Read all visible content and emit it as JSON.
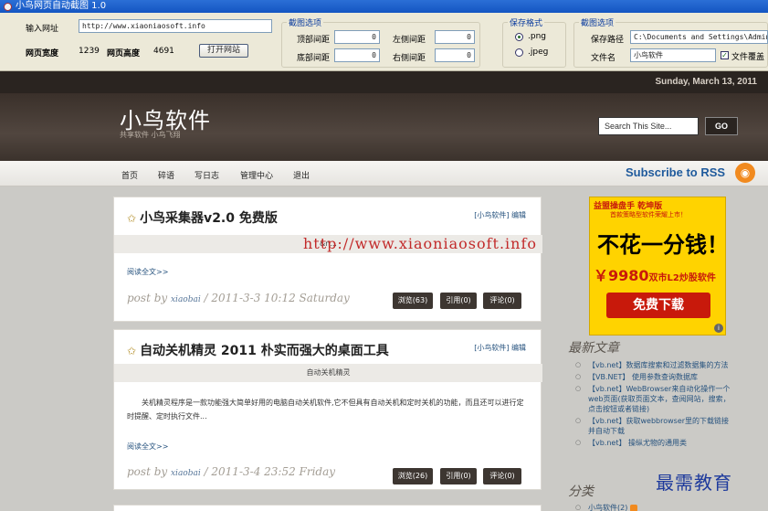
{
  "window": {
    "title": "小鸟网页自动截图 1.0"
  },
  "toolbar": {
    "url_label": "输入网址",
    "url_value": "http://www.xiaoniaosoft.info",
    "width_label": "网页宽度",
    "width_value": "1239",
    "height_label": "网页高度",
    "height_value": "4691",
    "open_button": "打开网站",
    "capture_group": "截图选项",
    "top_label": "顶部间距",
    "top_value": "0",
    "left_label": "左侧间距",
    "left_value": "0",
    "bottom_label": "底部间距",
    "bottom_value": "0",
    "right_label": "右侧间距",
    "right_value": "0",
    "format_group": "保存格式",
    "format_png": ".png",
    "format_jpeg": ".jpeg",
    "format_selected": "png",
    "save_group": "截图选项",
    "save_path_label": "保存路径",
    "save_path_value": "C:\\Documents and Settings\\Admini",
    "filename_label": "文件名",
    "filename_value": "小鸟软件",
    "overwrite_label": "文件覆盖",
    "overwrite_checked": true
  },
  "site": {
    "date": "Sunday, March 13, 2011",
    "title": "小鸟软件",
    "subtitle": "共享软件  小鸟飞翔",
    "search_placeholder": "Search This Site...",
    "search_button": "GO",
    "nav": [
      "首页",
      "碎语",
      "写日志",
      "管理中心",
      "退出"
    ],
    "subscribe": "Subscribe to RSS"
  },
  "watermark_url": "http://www.xiaoniaosoft.info",
  "posts": [
    {
      "title": "小鸟采集器v2.0 免费版",
      "category": "[小鸟软件]",
      "edit": "编辑",
      "excerpt": "&n...",
      "readmore": "阅读全文>>",
      "meta_prefix": "post by ",
      "author": "xiaobai",
      "meta_date": " / 2011-3-3 10:12 Saturday",
      "views": "浏览(63)",
      "quotes": "引用(0)",
      "comments": "评论(0)"
    },
    {
      "title": "自动关机精灵 2011 朴实而强大的桌面工具",
      "category": "[小鸟软件]",
      "edit": "编辑",
      "excerpt": "自动关机精灵",
      "body": "关机精灵程序是一款功能强大简单好用的电脑自动关机软件,它不但具有自动关机和定时关机的功能，而且还可以进行定时提醒、定时执行文件...",
      "readmore": "阅读全文>>",
      "meta_prefix": "post by ",
      "author": "xiaobai",
      "meta_date": " / 2011-3-4 23:52 Friday",
      "views": "浏览(26)",
      "quotes": "引用(0)",
      "comments": "评论(0)"
    }
  ],
  "ad": {
    "logo": "益盟操盘手 乾坤版",
    "small": "首款策略型软件荣耀上市！",
    "headline": "不花一分钱！",
    "price": "￥9980",
    "price_sub": "双市L2炒股软件",
    "button": "免费下载"
  },
  "sidebar": {
    "recent_title": "最新文章",
    "recent": [
      "【vb.net】数据库搜索和过滤数据集的方法",
      "【VB.NET】 使用参数查询数据库",
      "【vb.net】WebBrowser来自动化操作一个web页面(获取页面文本，查阅网站，搜索，点击按钮或者链接)",
      "【vb.net】获取webbrowser里的下载链接并自动下载",
      "【vb.net】 操纵尤物的通用类"
    ],
    "category_title": "分类",
    "category_item": "小鸟软件(2)"
  },
  "corner_watermark": "最需教育",
  "colors": {
    "accent": "#1f5a9c",
    "header": "#3a302a",
    "watermark": "#c22a2a",
    "ad_yellow": "#ffd300"
  }
}
